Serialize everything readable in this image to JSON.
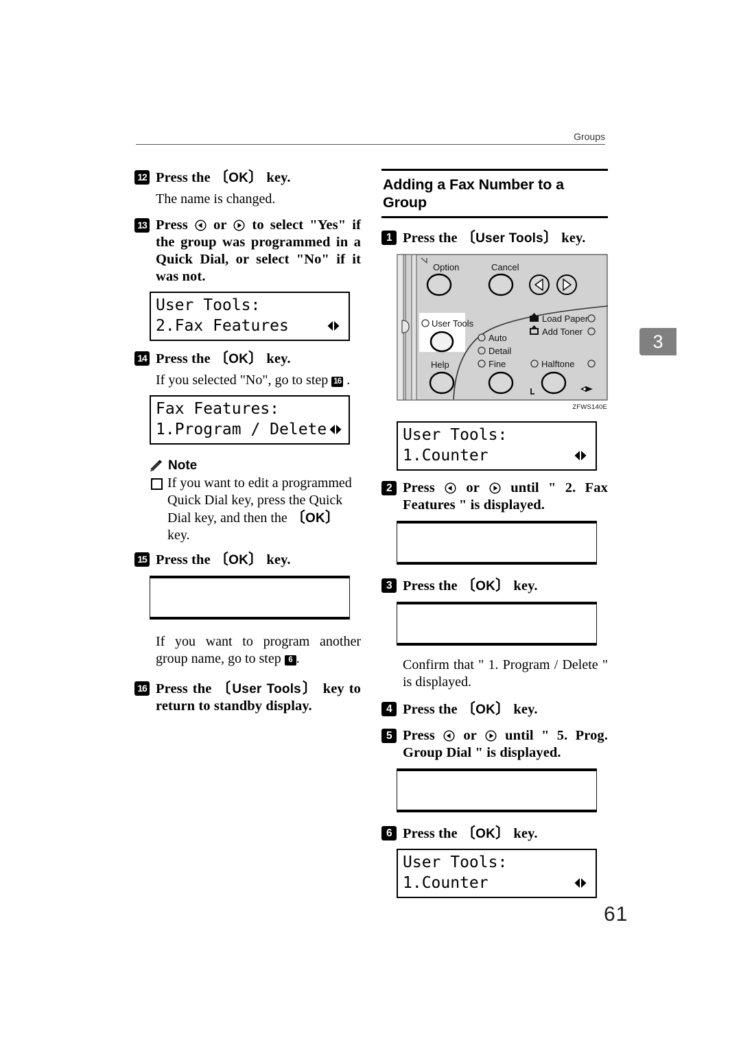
{
  "runhead": {
    "title": "Groups"
  },
  "chapter_tab": {
    "number": "3"
  },
  "page_number": "61",
  "left_column": {
    "step12": {
      "num": "12",
      "text_before": "Press the ",
      "keycap": "OK",
      "text_after": " key.",
      "body": "The name is changed."
    },
    "step13": {
      "num": "13",
      "line1_a": "Press ",
      "line1_or": " or ",
      "line1_b": " to select \"Yes\" if the group was programmed in a Quick Dial, or select \"No\" if it was not."
    },
    "lcd1": {
      "line1": "User Tools:",
      "line2": "2.Fax Features"
    },
    "step14": {
      "num": "14",
      "text_before": "Press the ",
      "keycap": "OK",
      "text_after": " key.",
      "body_a": "If you selected \"No\", go to step ",
      "body_ref": "16",
      "body_b": " ."
    },
    "lcd2": {
      "line1": "Fax Features:",
      "line2": "1.Program / Delete"
    },
    "note": {
      "label": "Note",
      "items": [
        "If you want to edit a programmed Quick Dial key, press the Quick Dial key, and then the "
      ],
      "item1_keycap": "OK",
      "item1_tail": " key."
    },
    "step15": {
      "num": "15",
      "text_before": "Press the ",
      "keycap": "OK",
      "text_after": " key."
    },
    "after15": {
      "line_a": "If you want to program another group name, go to step ",
      "ref": "6",
      "line_b": "."
    },
    "step16": {
      "num": "16",
      "text_before": "Press the ",
      "keycap": "User Tools",
      "text_after": " key to return to standby display."
    }
  },
  "right_column": {
    "section_title": "Adding a Fax Number to a Group",
    "step1": {
      "num": "1",
      "text_before": "Press the ",
      "keycap": "User Tools",
      "text_after": " key."
    },
    "figure": {
      "caption": "ZFWS140E",
      "labels": {
        "option": "Option",
        "cancel": "Cancel",
        "user_tools": "User Tools",
        "help": "Help",
        "auto": "Auto",
        "detail": "Detail",
        "fine": "Fine",
        "halftone": "Halftone",
        "load_paper": "Load Paper",
        "add_toner": "Add Toner"
      },
      "panel_fill": "#d2d2d2",
      "highlight_fill": "#ffffff"
    },
    "lcd1": {
      "line1": "User Tools:",
      "line2": "1.Counter"
    },
    "step2": {
      "num": "2",
      "a": "Press ",
      "or": " or ",
      "b": " until \" 2. Fax Features \" is displayed."
    },
    "step3": {
      "num": "3",
      "text_before": "Press the ",
      "keycap": "OK",
      "text_after": " key."
    },
    "confirm": "Confirm that \" 1. Program / Delete \" is displayed.",
    "step4": {
      "num": "4",
      "text_before": "Press the ",
      "keycap": "OK",
      "text_after": " key."
    },
    "step5": {
      "num": "5",
      "a": "Press ",
      "or": " or ",
      "b": " until \" 5. Prog. Group Dial \" is displayed."
    },
    "step6": {
      "num": "6",
      "text_before": "Press the ",
      "keycap": "OK",
      "text_after": " key."
    },
    "lcd2": {
      "line1": "User Tools:",
      "line2": "1.Counter"
    }
  }
}
